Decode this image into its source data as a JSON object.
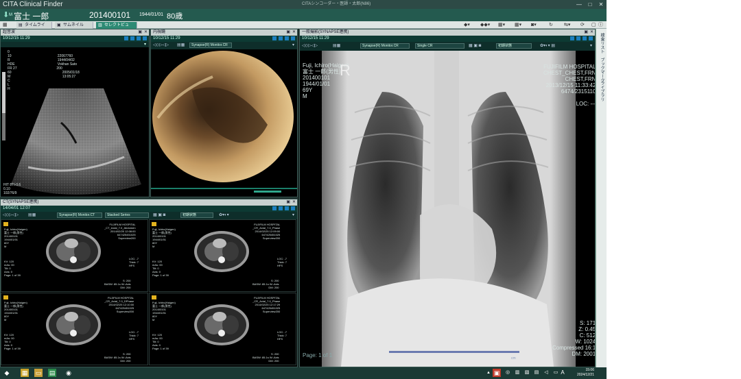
{
  "app": {
    "title": "CITA Clinical Finder",
    "center_title": "CITAシンコーダー・医師・太郎(N86)",
    "window_controls": [
      "—",
      "□",
      "✕"
    ]
  },
  "patient": {
    "name": "富士 一郎",
    "sex_marker": "M",
    "id": "201400101",
    "dob": "1944/01/01",
    "age": "80歳"
  },
  "tabs": [
    {
      "label": "タイムライン"
    },
    {
      "label": "サムネイル"
    },
    {
      "label": "セレクトビュー"
    }
  ],
  "sidepanel": {
    "items": [
      "検査リスト",
      "ブックマーク",
      "ライブラリ"
    ]
  },
  "panels": {
    "ultrasound": {
      "title": "超音波",
      "timestamp": "10/12/15 11:29",
      "overlay_left": "0\n10\nR\nHDE\nFR 27\n60\nM\nC\nL\nH",
      "overlay_top": "  22067760\n  1944/04/02\n  Vokhan Sato\n 200\n       2005/01/18\n       13:05:27",
      "overlay_bottom": "HIT 8TI-0.6\n0.10\n102/76/9"
    },
    "endoscopy": {
      "title": "内視鏡",
      "timestamp": "10/12/15 11:29",
      "dropdown": "Synapse(R) Monitor.CR"
    },
    "ct": {
      "title": "CT(SYNAPSE連携)",
      "timestamp": "14/04/01 12:07",
      "dropdown1": "Synapse(R) Monitor.CT",
      "dropdown2": "Stacked Series",
      "dropdown3": "初期状態",
      "cells": [
        {
          "patient": "Fuji, Ichiro(Haigen)\n富士 一郎(男性)\n201400101\n1944/01/01\n80Y\nM",
          "hospital": "FUJIFILM HOSPITAL\n_CT_Axial_7.0_Abdomen\n2014/02/25 12:08:00\n647425451025\nSuperview200",
          "params": "KV: 120\nmAs: 00\nTilt: 0\nAxis: 0\nPage: 1 of 39",
          "wl": "LOC: -7\nThick: 7\nHFS",
          "bottom": "S: 200\nBASW: 85.1s W:-Axis\nDM: 200"
        },
        {
          "patient": "Fuji, Ichiro(Haigen)\n富士 一郎(男性)\n201400101\n1944/01/01\n80Y\nM",
          "hospital": "FUJIFILM HOSPITAL\n_CR_Axial_7.0_Phase\n2014/02/25 12:09:00\n647425451025\nSuperview200",
          "params": "KV: 120\nmAs: 00\nTilt: 0\nAxis: 0\nPage: 1 of 39",
          "wl": "LOC: -7\nThick: 7\nHFS",
          "bottom": "S: 200\nBASW: 85.1s W:-Axis\nDM: 200"
        },
        {
          "patient": "Fuji, Ichiro(Haigen)\n富士 一郎(男性)\n201400101\n1944/01/01\n80Y\nM",
          "hospital": "FUJIFILM HOSPITAL\n_CR_Axial_7.0_DPhase\n2014/02/25 12:10:00\n647425451025\nSuperview200",
          "params": "KV: 120\nmAs: 00\nTilt: 0\nAxis: 0\nPage: 1 of 39",
          "wl": "LOC: -7\nThick: 7\nHFS",
          "bottom": "S: 200\nBASW: 85.1s W:-Axis\nDM: 200"
        },
        {
          "patient": "Fuji, Ichiro(Haigen)\n富士 一郎(男性)\n201400101\n1944/01/01\n80Y\nM",
          "hospital": "FUJIFILM HOSPITAL\n_CR_Axial_7.0_Phase\n2014/02/25 12:17:29\n647425451025\nSuperview200",
          "params": "KV: 120\nmAs: 00\nTilt: 0\nAxis: 0\nPage: 1 of 39",
          "wl": "LOC: -7\nThick: 7\nHFS",
          "bottom": "S: 200\nBASW: 85.1s W:-Axis\nDM: 200"
        }
      ]
    },
    "xray": {
      "title": "一般撮影(SYNAPSE連携)",
      "timestamp": "10/12/15 11:29",
      "dropdown1": "Synapse(R) Monitor.CR",
      "dropdown2": "Single CR",
      "dropdown3": "初期状態",
      "patient_overlay": "Fuji, Ichiro(Haigen)\n富士 一郎(男性)\n201400101\n1944/01/01\n69Y\nM",
      "marker": "R",
      "hospital_overlay": "FUJIFILM HOSPITAL\nCHEST_CHEST,FRN\nCHEST,FRN\n2013/12/15 11:33:42\n6474/2315110\n\nLOC: ---",
      "bottom_left": "Page: 1 of 1",
      "bottom_right": "S: 171\nZ: 0.45\nC: 512\nW: 1024\nCompressed 16:1\nDM: 2001",
      "scale_label": "cm"
    }
  },
  "taskbar": {
    "time": "15:06",
    "date": "2024/12/21",
    "lang": "A"
  }
}
